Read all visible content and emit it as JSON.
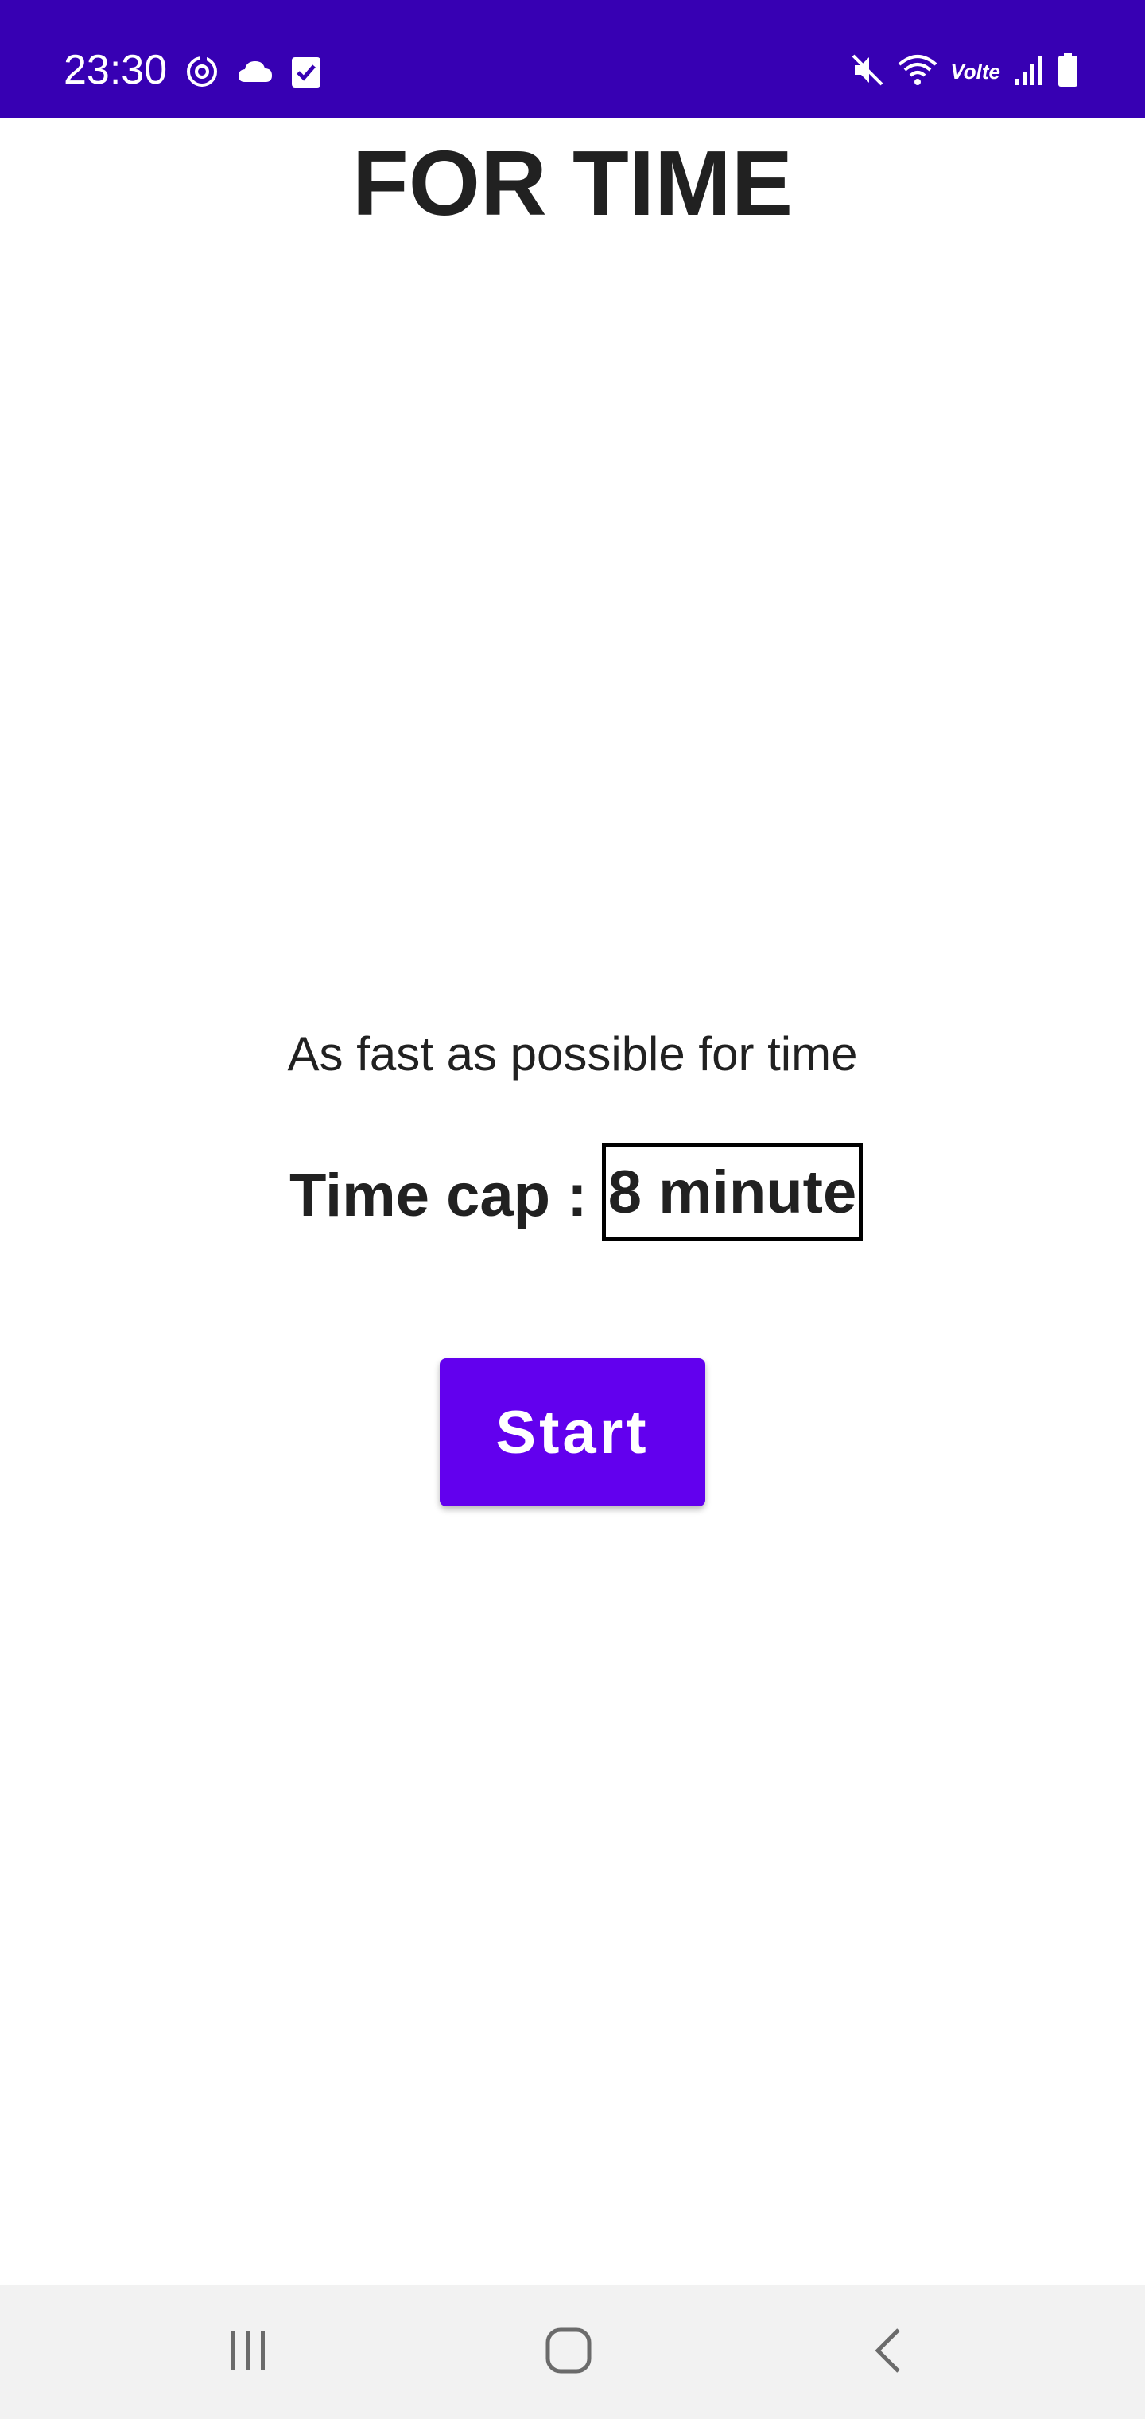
{
  "status_bar": {
    "time": "23:30",
    "left_icons": [
      "sync-icon",
      "cloud-icon",
      "checkbox-icon"
    ],
    "right_icons": [
      "mute-icon",
      "wifi-icon",
      "volte-icon",
      "signal-icon",
      "battery-icon"
    ],
    "volte_text": "Volte",
    "background_color": "#3700B3"
  },
  "screen": {
    "title": "FOR TIME",
    "subtitle": "As fast as possible for time",
    "time_cap_label": "Time cap :",
    "time_cap_value": "8 minute",
    "start_label": "Start",
    "accent_color": "#6200EE"
  },
  "nav_bar": {
    "buttons": [
      "recent-apps-icon",
      "home-icon",
      "back-icon"
    ]
  }
}
